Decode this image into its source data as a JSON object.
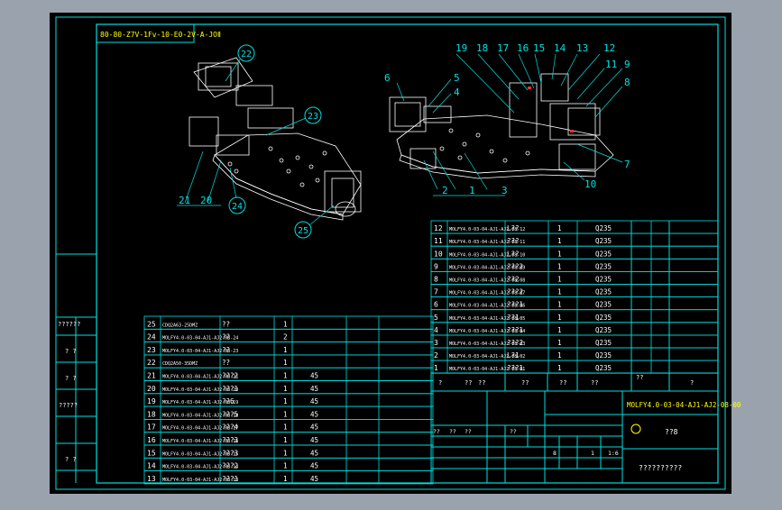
{
  "drawing": {
    "code_label": "80-80-Z7V-1Fⅴ-10-E0-2V-A-JOⅡ",
    "parts_right": [
      {
        "no": "12",
        "code": "MOLFY4.0-03-04-AJ1-AJ2-08-12",
        "name": "L??",
        "qty": "1",
        "mat": "Q235"
      },
      {
        "no": "11",
        "code": "MOLFY4.0-03-04-AJ1-AJ2-08-11",
        "name": "???",
        "qty": "1",
        "mat": "Q235"
      },
      {
        "no": "10",
        "code": "MOLFY4.0-03-04-AJ1-AJ2-08-10",
        "name": "L??",
        "qty": "1",
        "mat": "Q235"
      },
      {
        "no": "9",
        "code": "MOLFY4.0-03-04-AJ1-AJ2-08-09",
        "name": "???2",
        "qty": "1",
        "mat": "Q235"
      },
      {
        "no": "8",
        "code": "MOLFY4.0-03-04-AJ1-AJ2-08-08",
        "name": "??2",
        "qty": "1",
        "mat": "Q235"
      },
      {
        "no": "7",
        "code": "MOLFY4.0-03-04-AJ1-AJ2-08-07",
        "name": "???2",
        "qty": "1",
        "mat": "Q235"
      },
      {
        "no": "6",
        "code": "MOLFY4.0-03-04-AJ1-AJ2-08-06",
        "name": "???1",
        "qty": "1",
        "mat": "Q235"
      },
      {
        "no": "5",
        "code": "MOLFY4.0-03-04-AJ1-AJ2-08-05",
        "name": "??1",
        "qty": "1",
        "mat": "Q235"
      },
      {
        "no": "4",
        "code": "MOLFY4.0-03-04-AJ1-AJ2-08-04",
        "name": "???1",
        "qty": "1",
        "mat": "Q235"
      },
      {
        "no": "3",
        "code": "MOLFY4.0-03-04-AJ1-AJ2-08-03",
        "name": "???2",
        "qty": "1",
        "mat": "Q235"
      },
      {
        "no": "2",
        "code": "MOLFY4.0-03-04-AJ1-AJ2-08-02",
        "name": "L?1",
        "qty": "1",
        "mat": "Q235"
      },
      {
        "no": "1",
        "code": "MOLFY4.0-03-04-AJ1-AJ2-08-01",
        "name": "???1",
        "qty": "1",
        "mat": "Q235"
      }
    ],
    "parts_left": [
      {
        "no": "25",
        "code": "CDQ2A63-25DMZ",
        "name": "??",
        "qty": "1",
        "mat": ""
      },
      {
        "no": "24",
        "code": "MOLFY4.0-03-04-AJ1-AJ2-08-24",
        "name": "??",
        "qty": "2",
        "mat": ""
      },
      {
        "no": "23",
        "code": "MOLFY4.0-03-04-AJ1-AJ2-08-23",
        "name": "??",
        "qty": "1",
        "mat": ""
      },
      {
        "no": "22",
        "code": "CDQ2A50-35DMZ",
        "name": "??",
        "qty": "1",
        "mat": ""
      },
      {
        "no": "21",
        "code": "MOLFY4.0-03-04-AJ1-AJ2-08-21",
        "name": "???2",
        "qty": "1",
        "mat": "45"
      },
      {
        "no": "20",
        "code": "MOLFY4.0-03-04-AJ1-AJ2-08-20",
        "name": "???1",
        "qty": "1",
        "mat": "45"
      },
      {
        "no": "19",
        "code": "MOLFY4.0-03-04-AJ1-AJ2-08-19",
        "name": "??6",
        "qty": "1",
        "mat": "45"
      },
      {
        "no": "18",
        "code": "MOLFY4.0-03-04-AJ1-AJ2-08-18",
        "name": "???5",
        "qty": "1",
        "mat": "45"
      },
      {
        "no": "17",
        "code": "MOLFY4.0-03-04-AJ1-AJ2-08-17",
        "name": "???4",
        "qty": "1",
        "mat": "45"
      },
      {
        "no": "16",
        "code": "MOLFY4.0-03-04-AJ1-AJ2-08-16",
        "name": "???3",
        "qty": "1",
        "mat": "45"
      },
      {
        "no": "15",
        "code": "MOLFY4.0-03-04-AJ1-AJ2-08-15",
        "name": "???3",
        "qty": "1",
        "mat": "45"
      },
      {
        "no": "14",
        "code": "MOLFY4.0-03-04-AJ1-AJ2-08-14",
        "name": "???2",
        "qty": "1",
        "mat": "45"
      },
      {
        "no": "13",
        "code": "MOLFY4.0-03-04-AJ1-AJ2-08-13",
        "name": "???1",
        "qty": "1",
        "mat": "45"
      }
    ],
    "header_row_right": [
      "?",
      "??",
      "??",
      "??",
      "??",
      "??",
      "??",
      "?"
    ],
    "drawing_number": "MOLFY4.0-03-04-AJ1-AJ2-08-00",
    "title_name": "??8",
    "company": "??????????",
    "scale_row": [
      "??",
      "??",
      "??",
      "??"
    ],
    "weight_vals": [
      "8",
      "1",
      "1:6"
    ],
    "left_stamp": [
      "??????",
      "? ?",
      "? ?",
      "?????",
      "? ?"
    ],
    "callouts_left": [
      "22",
      "23",
      "21",
      "20",
      "24",
      "25"
    ],
    "callouts_right": [
      "19",
      "18",
      "17",
      "16",
      "15",
      "14",
      "13",
      "12",
      "11",
      "9",
      "8",
      "7",
      "6",
      "5",
      "4",
      "2",
      "1",
      "3",
      "10"
    ],
    "colors": {
      "bg": "#000000",
      "line": "#00ffff",
      "text": "#ffffff",
      "yellow": "#ffff00",
      "red": "#ff3030"
    }
  }
}
